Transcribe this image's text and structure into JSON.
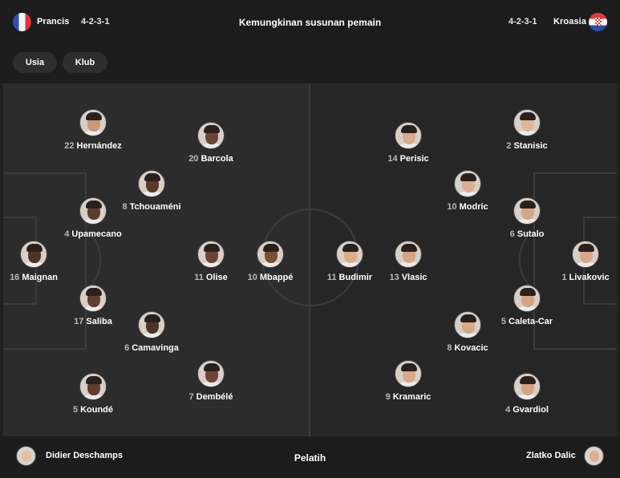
{
  "header": {
    "title": "Kemungkinan susunan pemain",
    "home": {
      "name": "Prancis",
      "formation": "4-2-3-1",
      "flag_icon": "france-flag-icon"
    },
    "away": {
      "name": "Kroasia",
      "formation": "4-2-3-1",
      "flag_icon": "croatia-flag-icon"
    }
  },
  "filters": {
    "tabs": [
      {
        "label": "Usia"
      },
      {
        "label": "Klub"
      }
    ]
  },
  "home_players": [
    {
      "number": "22",
      "name": "Hernández",
      "skin": "#c99a79"
    },
    {
      "number": "20",
      "name": "Barcola",
      "skin": "#6b4634"
    },
    {
      "number": "8",
      "name": "Tchouaméni",
      "skin": "#5a3a2a"
    },
    {
      "number": "4",
      "name": "Upamecano",
      "skin": "#5c3d2c"
    },
    {
      "number": "16",
      "name": "Maignan",
      "skin": "#4e3426"
    },
    {
      "number": "11",
      "name": "Olise",
      "skin": "#6a4533"
    },
    {
      "number": "10",
      "name": "Mbappé",
      "skin": "#7a5138"
    },
    {
      "number": "17",
      "name": "Saliba",
      "skin": "#5f3f2e"
    },
    {
      "number": "6",
      "name": "Camavinga",
      "skin": "#4f3527"
    },
    {
      "number": "7",
      "name": "Dembélé",
      "skin": "#6c4634"
    },
    {
      "number": "5",
      "name": "Koundé",
      "skin": "#5e3e2d"
    }
  ],
  "away_players": [
    {
      "number": "14",
      "name": "Perisic",
      "skin": "#d8ab8a"
    },
    {
      "number": "2",
      "name": "Stanisic",
      "skin": "#e1b596"
    },
    {
      "number": "10",
      "name": "Modric",
      "skin": "#dcae8f"
    },
    {
      "number": "6",
      "name": "Sutalo",
      "skin": "#d6a786"
    },
    {
      "number": "11",
      "name": "Budimir",
      "skin": "#d9ac8c"
    },
    {
      "number": "13",
      "name": "Vlasic",
      "skin": "#d5a585"
    },
    {
      "number": "1",
      "name": "Livakovic",
      "skin": "#d8a988"
    },
    {
      "number": "5",
      "name": "Caleta-Car",
      "skin": "#d3a382"
    },
    {
      "number": "8",
      "name": "Kovacic",
      "skin": "#d6a887"
    },
    {
      "number": "9",
      "name": "Kramaric",
      "skin": "#d9ab8b"
    },
    {
      "number": "4",
      "name": "Gvardiol",
      "skin": "#d4a584"
    }
  ],
  "coaches": {
    "label": "Pelatih",
    "home": {
      "name": "Didier Deschamps"
    },
    "away": {
      "name": "Zlatko Dalic"
    }
  }
}
